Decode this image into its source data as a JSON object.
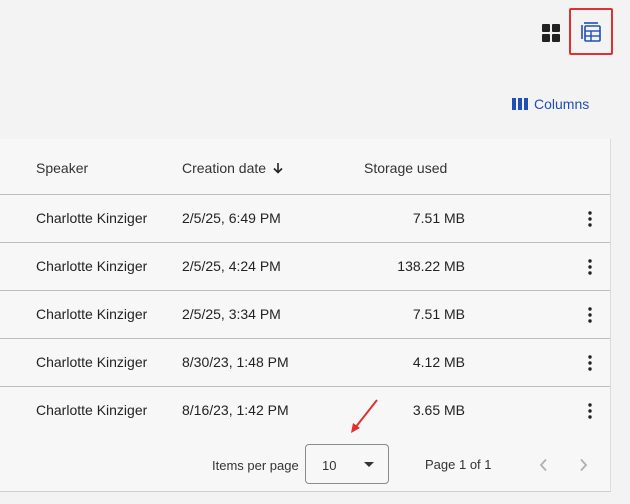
{
  "toolbar": {
    "grid_view_icon": "grid-view-icon",
    "table_view_icon": "table-view-icon",
    "columns_label": "Columns",
    "columns_icon": "columns-icon"
  },
  "table": {
    "headers": {
      "speaker": "Speaker",
      "creation_date": "Creation date",
      "storage_used": "Storage used"
    },
    "sort": {
      "column": "creation_date",
      "direction": "descending"
    },
    "rows": [
      {
        "speaker": "Charlotte Kinziger",
        "creation_date": "2/5/25, 6:49 PM",
        "storage_used": "7.51 MB"
      },
      {
        "speaker": "Charlotte Kinziger",
        "creation_date": "2/5/25, 4:24 PM",
        "storage_used": "138.22 MB"
      },
      {
        "speaker": "Charlotte Kinziger",
        "creation_date": "2/5/25, 3:34 PM",
        "storage_used": "7.51 MB"
      },
      {
        "speaker": "Charlotte Kinziger",
        "creation_date": "8/30/23, 1:48 PM",
        "storage_used": "4.12 MB"
      },
      {
        "speaker": "Charlotte Kinziger",
        "creation_date": "8/16/23, 1:42 PM",
        "storage_used": "3.65 MB"
      }
    ]
  },
  "pagination": {
    "items_per_page_label": "Items per page",
    "items_per_page_value": "10",
    "page_label": "Page 1 of 1"
  },
  "colors": {
    "accent": "#1f4fb3",
    "highlight_border": "#e03131",
    "annotation_arrow": "#e03131"
  }
}
